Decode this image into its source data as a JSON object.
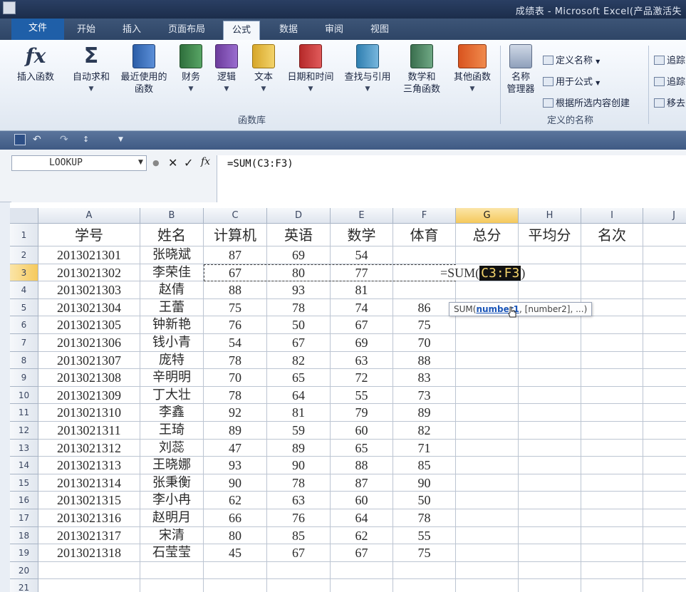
{
  "window": {
    "title": "成绩表  - Microsoft Excel(产品激活失"
  },
  "tabs": [
    {
      "label": "文件"
    },
    {
      "label": "开始"
    },
    {
      "label": "插入"
    },
    {
      "label": "页面布局"
    },
    {
      "label": "公式"
    },
    {
      "label": "数据"
    },
    {
      "label": "审阅"
    },
    {
      "label": "视图"
    }
  ],
  "ribbon": {
    "function_library": {
      "group_label": "函数库",
      "buttons": [
        {
          "label": "插入函数",
          "icon": "fx-icon"
        },
        {
          "label": "自动求和",
          "icon": "sigma-icon"
        },
        {
          "label": "最近使用的",
          "label2": "函数",
          "icon": "star-book-icon"
        },
        {
          "label": "财务",
          "icon": "finance-book-icon"
        },
        {
          "label": "逻辑",
          "icon": "logic-book-icon"
        },
        {
          "label": "文本",
          "icon": "text-book-icon"
        },
        {
          "label": "日期和时间",
          "icon": "clock-book-icon"
        },
        {
          "label": "查找与引用",
          "icon": "search-book-icon"
        },
        {
          "label": "数学和",
          "label2": "三角函数",
          "icon": "math-book-icon"
        },
        {
          "label": "其他函数",
          "icon": "more-books-icon"
        }
      ]
    },
    "defined_names": {
      "group_label": "定义的名称",
      "name_manager_label": "名称",
      "name_manager_label2": "管理器",
      "define_name": "定义名称",
      "use_in_formula": "用于公式",
      "create_from_selection": "根据所选内容创建"
    },
    "auditing": {
      "trace1": "追踪",
      "trace2": "追踪",
      "remove": "移去"
    }
  },
  "colors": {
    "title_bar": "#1c2d4b",
    "accent": "#1f5fa8",
    "selection_header": "#f5c95c"
  },
  "formula_bar": {
    "name_box": "LOOKUP",
    "cancel": "✕",
    "enter": "✓",
    "fx": "fx",
    "formula": "=SUM(C3:F3)"
  },
  "sheet": {
    "column_headers": [
      "A",
      "B",
      "C",
      "D",
      "E",
      "F",
      "G",
      "H",
      "I",
      "J"
    ],
    "row_headers": [
      "1",
      "2",
      "3",
      "4",
      "5",
      "6",
      "7",
      "8",
      "9",
      "10",
      "11",
      "12",
      "13",
      "14",
      "15",
      "16",
      "17",
      "18",
      "19",
      "20",
      "21"
    ],
    "header_row": [
      "学号",
      "姓名",
      "计算机",
      "英语",
      "数学",
      "体育",
      "总分",
      "平均分",
      "名次"
    ],
    "rows": [
      [
        "2013021301",
        "张晓斌",
        "87",
        "69",
        "54",
        ""
      ],
      [
        "2013021302",
        "李荣佳",
        "67",
        "80",
        "77",
        ""
      ],
      [
        "2013021303",
        "赵倩",
        "88",
        "93",
        "81",
        ""
      ],
      [
        "2013021304",
        "王蕾",
        "75",
        "78",
        "74",
        "86"
      ],
      [
        "2013021305",
        "钟新艳",
        "76",
        "50",
        "67",
        "75"
      ],
      [
        "2013021306",
        "钱小青",
        "54",
        "67",
        "69",
        "70"
      ],
      [
        "2013021307",
        "庞特",
        "78",
        "82",
        "63",
        "88"
      ],
      [
        "2013021308",
        "辛明明",
        "70",
        "65",
        "72",
        "83"
      ],
      [
        "2013021309",
        "丁大壮",
        "78",
        "64",
        "55",
        "73"
      ],
      [
        "2013021310",
        "李鑫",
        "92",
        "81",
        "79",
        "89"
      ],
      [
        "2013021311",
        "王琦",
        "89",
        "59",
        "60",
        "82"
      ],
      [
        "2013021312",
        "刘蕊",
        "47",
        "89",
        "65",
        "71"
      ],
      [
        "2013021313",
        "王晓娜",
        "93",
        "90",
        "88",
        "85"
      ],
      [
        "2013021314",
        "张秉衡",
        "90",
        "78",
        "87",
        "90"
      ],
      [
        "2013021315",
        "李小冉",
        "62",
        "63",
        "60",
        "50"
      ],
      [
        "2013021316",
        "赵明月",
        "66",
        "76",
        "64",
        "78"
      ],
      [
        "2013021317",
        "宋清",
        "80",
        "85",
        "62",
        "55"
      ],
      [
        "2013021318",
        "石莹莹",
        "45",
        "67",
        "67",
        "75"
      ]
    ],
    "edit_cell": {
      "prefix": "=SUM(",
      "ref": "C3:F3",
      "suffix": ")"
    },
    "tooltip": {
      "fn": "SUM(",
      "arg": "number1",
      "rest": ", [number2], ...)"
    }
  }
}
